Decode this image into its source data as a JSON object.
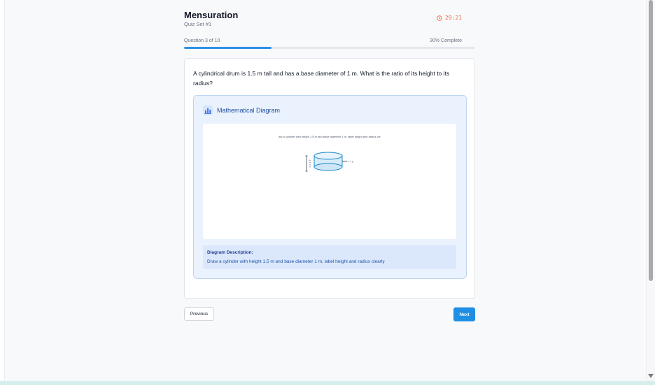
{
  "header": {
    "title": "Mensuration",
    "subtitle": "Quiz Set #1",
    "timer": "29:21"
  },
  "progress": {
    "label": "Question 3 of 10",
    "percent_label": "30% Complete",
    "fraction": 0.3
  },
  "question": {
    "text": "A cylindrical drum is 1.5 m tall and has a base diameter of 1 m. What is the ratio of its height to its radius?"
  },
  "diagram": {
    "title": "Mathematical Diagram",
    "caption": "aw a cylinder with height 1.5 m and base diameter 1 m, label height and radius cle",
    "height_label": "h = 1.5",
    "radius_label": "r = 3",
    "description_label": "Diagram Description:",
    "description_text": "Draw a cylinder with height 1.5 m and base diameter 1 m, label height and radius clearly"
  },
  "nav": {
    "previous_label": "Previous",
    "next_label": "Next"
  },
  "colors": {
    "accent": "#1f8fe5",
    "timer": "#ef6b3b",
    "diagram_bg": "#eaf2fd",
    "description_bg": "#dbe8fc"
  }
}
